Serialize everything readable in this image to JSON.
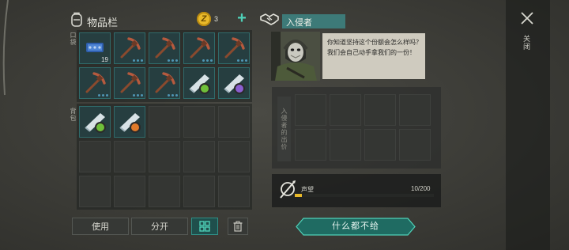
{
  "inventory": {
    "title": "物品栏",
    "coins": "3",
    "pocket_label": "口袋",
    "backpack_label": "背包",
    "pocket_slots": [
      {
        "item": "armor-plate",
        "count": "19",
        "dots": 0
      },
      {
        "item": "pickaxe",
        "count": "",
        "dots": 3
      },
      {
        "item": "pickaxe",
        "count": "",
        "dots": 3
      },
      {
        "item": "pickaxe",
        "count": "",
        "dots": 3
      },
      {
        "item": "pickaxe",
        "count": "",
        "dots": 3
      },
      {
        "item": "pickaxe",
        "count": "",
        "dots": 3
      },
      {
        "item": "pickaxe",
        "count": "",
        "dots": 3
      },
      {
        "item": "pickaxe",
        "count": "",
        "dots": 3
      },
      {
        "item": "blueprint-green",
        "count": "",
        "dots": 0
      },
      {
        "item": "blueprint-purple",
        "count": "",
        "dots": 0
      }
    ],
    "backpack_slots": [
      {
        "item": "blueprint-green"
      },
      {
        "item": "blueprint-orange"
      }
    ],
    "buttons": {
      "use": "使用",
      "split": "分开"
    }
  },
  "trader": {
    "name": "入侵者",
    "speech": "你知道坚持这个份额会怎么样吗？我们会自己动手拿我们的一份！",
    "offer_label": "入侵者的出价",
    "reputation_label": "声望",
    "reputation_value": "10/200",
    "reputation_fraction": 0.05,
    "give_nothing_button": "什么都不给"
  },
  "close": {
    "label": "关闭"
  },
  "colors": {
    "accent": "#4fd1b8",
    "coin": "#e8b92a",
    "slot_teal": "#263e40"
  }
}
